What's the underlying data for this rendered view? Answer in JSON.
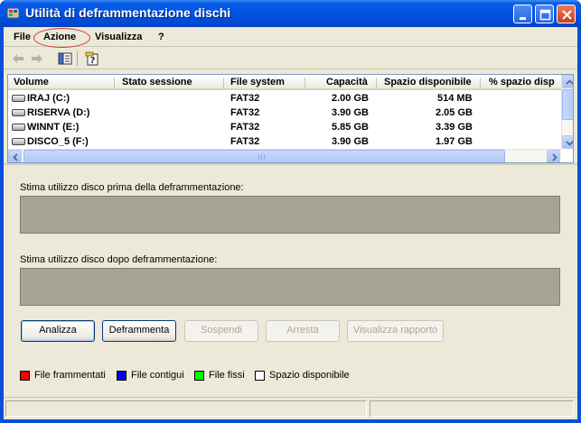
{
  "window": {
    "title": "Utilità di deframmentazione dischi"
  },
  "menu": {
    "items": [
      "File",
      "Azione",
      "Visualizza",
      "?"
    ]
  },
  "toolbar": {
    "icons": [
      "back-arrow-icon",
      "forward-arrow-icon",
      "show-hide-console-tree-icon",
      "properties-help-icon"
    ]
  },
  "volumes": {
    "columns": [
      "Volume",
      "Stato sessione",
      "File system",
      "Capacità",
      "Spazio disponibile",
      "% spazio disp"
    ],
    "rows": [
      {
        "volume": "IRAJ (C:)",
        "status": "",
        "fs": "FAT32",
        "capacity": "2.00 GB",
        "free": "514 MB",
        "pct": ""
      },
      {
        "volume": "RISERVA (D:)",
        "status": "",
        "fs": "FAT32",
        "capacity": "3.90 GB",
        "free": "2.05 GB",
        "pct": ""
      },
      {
        "volume": "WINNT (E:)",
        "status": "",
        "fs": "FAT32",
        "capacity": "5.85 GB",
        "free": "3.39 GB",
        "pct": ""
      },
      {
        "volume": "DISCO_5 (F:)",
        "status": "",
        "fs": "FAT32",
        "capacity": "3.90 GB",
        "free": "1.97 GB",
        "pct": ""
      }
    ]
  },
  "analysis": {
    "before_label": "Stima utilizzo disco prima della deframmentazione:",
    "after_label": "Stima utilizzo disco dopo deframmentazione:"
  },
  "buttons": {
    "analyze": "Analizza",
    "defrag": "Deframmenta",
    "pause": "Sospendi",
    "stop": "Arresta",
    "report": "Visualizza rapporto"
  },
  "legend": [
    {
      "label": "File frammentati",
      "color": "#ff0000"
    },
    {
      "label": "File contigui",
      "color": "#0000ff"
    },
    {
      "label": "File fissi",
      "color": "#00ff00"
    },
    {
      "label": "Spazio disponibile",
      "color": "#ffffff"
    }
  ],
  "colors": {
    "titlebar": "#0054e3",
    "usage_bar": "#a7a396",
    "highlight_oval": "#d8342a"
  }
}
